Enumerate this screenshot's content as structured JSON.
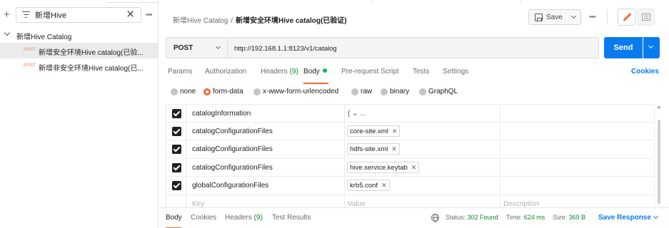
{
  "sidebar": {
    "search_value": "新增Hive",
    "collection": {
      "name": "新增Hive Catalog",
      "requests": [
        {
          "method": "POST",
          "name": "新增安全环境Hive catalog(已验...",
          "active": true
        },
        {
          "method": "POST",
          "name": "新增非安全环境Hive catalog(已...",
          "active": false
        }
      ]
    }
  },
  "header": {
    "breadcrumb_parent": "新增Hive Catalog",
    "breadcrumb_sep": "/",
    "breadcrumb_current": "新增安全环境Hive catalog(已验证)",
    "save_label": "Save"
  },
  "request": {
    "method": "POST",
    "url": "http://192.168.1.1:8123/v1/catalog",
    "send_label": "Send"
  },
  "tabs": {
    "params": "Params",
    "authorization": "Authorization",
    "headers": "Headers",
    "headers_count": "(9)",
    "body": "Body",
    "prerequest": "Pre-request Script",
    "tests": "Tests",
    "settings": "Settings",
    "cookies": "Cookies"
  },
  "body_types": {
    "none": "none",
    "form_data": "form-data",
    "urlencoded": "x-www-form-urlencoded",
    "raw": "raw",
    "binary": "binary",
    "graphql": "GraphQL"
  },
  "form_rows": [
    {
      "key": "catalogInformation",
      "value": "{ ⌄ ...",
      "type": "text"
    },
    {
      "key": "catalogConfigurationFiles",
      "value": "core-site.xml",
      "type": "file"
    },
    {
      "key": "catalogConfigurationFiles",
      "value": "hdfs-site.xml",
      "type": "file"
    },
    {
      "key": "catalogConfigurationFiles",
      "value": "hive.service.keytab",
      "type": "file"
    },
    {
      "key": "globalConfigurationFiles",
      "value": "krb5.conf",
      "type": "file"
    }
  ],
  "placeholders": {
    "key": "Key",
    "value": "Value",
    "description": "Description"
  },
  "response": {
    "body": "Body",
    "cookies": "Cookies",
    "headers": "Headers",
    "headers_count": "(9)",
    "test_results": "Test Results",
    "status_label": "Status:",
    "status_value": "302 Found",
    "time_label": "Time:",
    "time_value": "624 ms",
    "size_label": "Size:",
    "size_value": "369 B",
    "save_response": "Save Response"
  },
  "colors": {
    "accent": "#f26b3a",
    "send": "#097bed",
    "success": "#0f8a2c"
  }
}
